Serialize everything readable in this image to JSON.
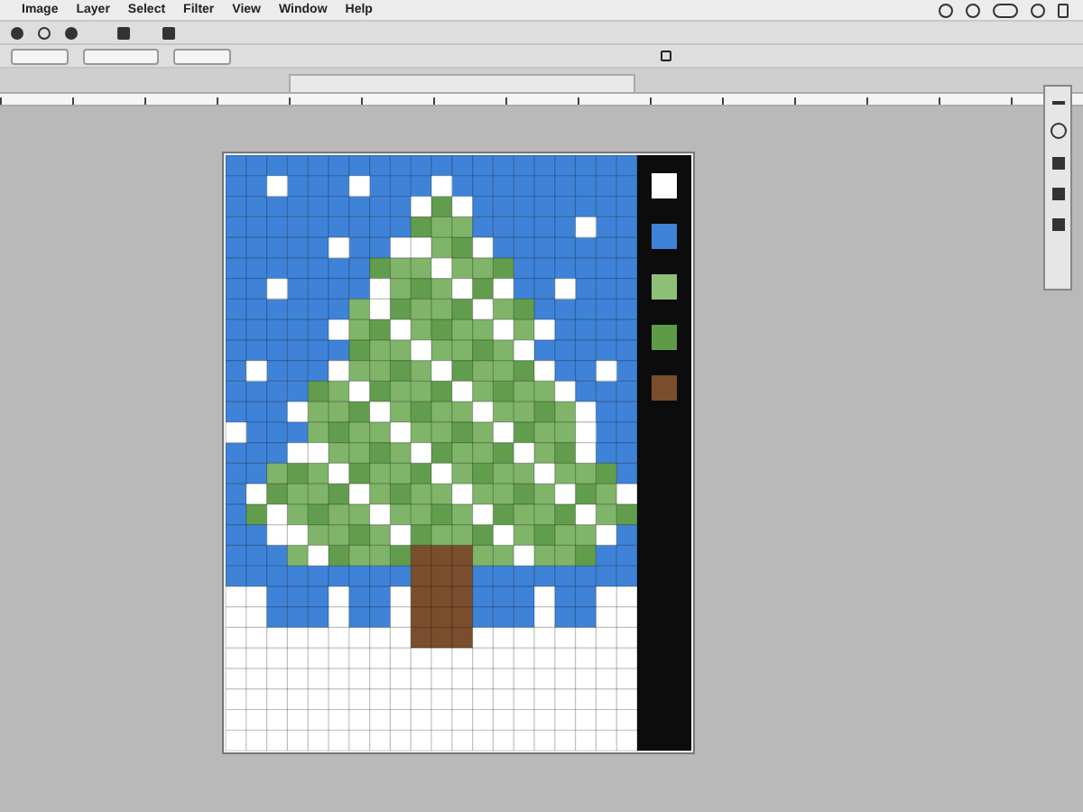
{
  "menu": [
    "Image",
    "Layer",
    "Select",
    "Filter",
    "View",
    "Window",
    "Help"
  ],
  "palette": [
    {
      "color": "#ffffff"
    },
    {
      "color": "#3f83d8"
    },
    {
      "color": "#8fc078"
    },
    {
      "color": "#5f9a48"
    },
    {
      "color": "#7a4e2c"
    }
  ]
}
